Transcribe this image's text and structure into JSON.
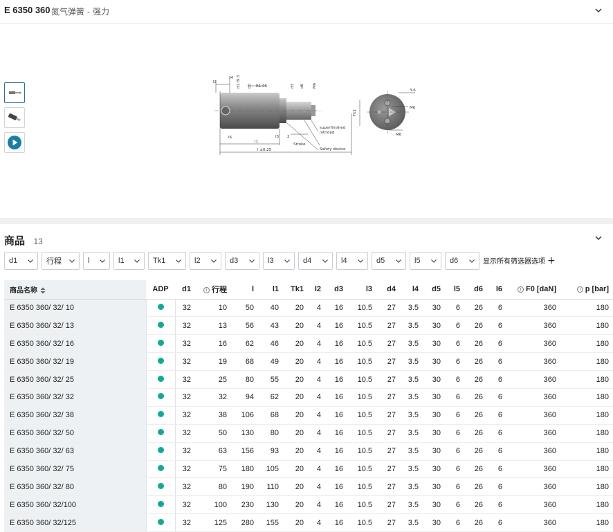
{
  "header": {
    "code": "E 6350 360",
    "name": "氮气弹簧 - 强力"
  },
  "drawing_labels": {
    "l2": "l2",
    "l4": "l4",
    "d1": "d1 f9.3",
    "d5": "d5",
    "r": "R1.05",
    "d3": "d3",
    "d6": "d6",
    "m6": "M6",
    "l6": "l6",
    "l1": "l1",
    "l3": "l3",
    "two": "2",
    "stroke": "Stroke",
    "l": "l ±0.25",
    "finish": "superfinished",
    "nitrided": "nitrided",
    "safety": "Safety device",
    "tk1": "Tk1",
    "dim36": "3.6",
    "m6b": "M6",
    "m6c": "M6"
  },
  "products": {
    "title": "商品",
    "count": "13",
    "filters": [
      "d1",
      "行程",
      "l",
      "l1",
      "Tk1",
      "l2",
      "d3",
      "l3",
      "d4",
      "l4",
      "d5",
      "l5",
      "d6"
    ],
    "show_all": "显示所有筛选器选项",
    "columns": [
      "商品名称",
      "ADP",
      "d1",
      "行程",
      "l",
      "l1",
      "Tk1",
      "l2",
      "d3",
      "l3",
      "d4",
      "l4",
      "d5",
      "l5",
      "d6",
      "l6",
      "F0 [daN]",
      "p [bar]"
    ],
    "rows": [
      {
        "name": "E 6350 360/ 32/ 10",
        "d1": "32",
        "stroke": "10",
        "l": "50",
        "l1": "40",
        "tk1": "20",
        "l2": "4",
        "d3": "16",
        "l3": "10.5",
        "d4": "27",
        "l4": "3.5",
        "d5": "30",
        "l5": "6",
        "d6": "26",
        "l6": "6",
        "f0": "360",
        "p": "180"
      },
      {
        "name": "E 6350 360/ 32/ 13",
        "d1": "32",
        "stroke": "13",
        "l": "56",
        "l1": "43",
        "tk1": "20",
        "l2": "4",
        "d3": "16",
        "l3": "10.5",
        "d4": "27",
        "l4": "3.5",
        "d5": "30",
        "l5": "6",
        "d6": "26",
        "l6": "6",
        "f0": "360",
        "p": "180"
      },
      {
        "name": "E 6350 360/ 32/ 16",
        "d1": "32",
        "stroke": "16",
        "l": "62",
        "l1": "46",
        "tk1": "20",
        "l2": "4",
        "d3": "16",
        "l3": "10.5",
        "d4": "27",
        "l4": "3.5",
        "d5": "30",
        "l5": "6",
        "d6": "26",
        "l6": "6",
        "f0": "360",
        "p": "180"
      },
      {
        "name": "E 6350 360/ 32/ 19",
        "d1": "32",
        "stroke": "19",
        "l": "68",
        "l1": "49",
        "tk1": "20",
        "l2": "4",
        "d3": "16",
        "l3": "10.5",
        "d4": "27",
        "l4": "3.5",
        "d5": "30",
        "l5": "6",
        "d6": "26",
        "l6": "6",
        "f0": "360",
        "p": "180"
      },
      {
        "name": "E 6350 360/ 32/ 25",
        "d1": "32",
        "stroke": "25",
        "l": "80",
        "l1": "55",
        "tk1": "20",
        "l2": "4",
        "d3": "16",
        "l3": "10.5",
        "d4": "27",
        "l4": "3.5",
        "d5": "30",
        "l5": "6",
        "d6": "26",
        "l6": "6",
        "f0": "360",
        "p": "180"
      },
      {
        "name": "E 6350 360/ 32/ 32",
        "d1": "32",
        "stroke": "32",
        "l": "94",
        "l1": "62",
        "tk1": "20",
        "l2": "4",
        "d3": "16",
        "l3": "10.5",
        "d4": "27",
        "l4": "3.5",
        "d5": "30",
        "l5": "6",
        "d6": "26",
        "l6": "6",
        "f0": "360",
        "p": "180"
      },
      {
        "name": "E 6350 360/ 32/ 38",
        "d1": "32",
        "stroke": "38",
        "l": "106",
        "l1": "68",
        "tk1": "20",
        "l2": "4",
        "d3": "16",
        "l3": "10.5",
        "d4": "27",
        "l4": "3.5",
        "d5": "30",
        "l5": "6",
        "d6": "26",
        "l6": "6",
        "f0": "360",
        "p": "180"
      },
      {
        "name": "E 6350 360/ 32/ 50",
        "d1": "32",
        "stroke": "50",
        "l": "130",
        "l1": "80",
        "tk1": "20",
        "l2": "4",
        "d3": "16",
        "l3": "10.5",
        "d4": "27",
        "l4": "3.5",
        "d5": "30",
        "l5": "6",
        "d6": "26",
        "l6": "6",
        "f0": "360",
        "p": "180"
      },
      {
        "name": "E 6350 360/ 32/ 63",
        "d1": "32",
        "stroke": "63",
        "l": "156",
        "l1": "93",
        "tk1": "20",
        "l2": "4",
        "d3": "16",
        "l3": "10.5",
        "d4": "27",
        "l4": "3.5",
        "d5": "30",
        "l5": "6",
        "d6": "26",
        "l6": "6",
        "f0": "360",
        "p": "180"
      },
      {
        "name": "E 6350 360/ 32/ 75",
        "d1": "32",
        "stroke": "75",
        "l": "180",
        "l1": "105",
        "tk1": "20",
        "l2": "4",
        "d3": "16",
        "l3": "10.5",
        "d4": "27",
        "l4": "3.5",
        "d5": "30",
        "l5": "6",
        "d6": "26",
        "l6": "6",
        "f0": "360",
        "p": "180"
      },
      {
        "name": "E 6350 360/ 32/ 80",
        "d1": "32",
        "stroke": "80",
        "l": "190",
        "l1": "110",
        "tk1": "20",
        "l2": "4",
        "d3": "16",
        "l3": "10.5",
        "d4": "27",
        "l4": "3.5",
        "d5": "30",
        "l5": "6",
        "d6": "26",
        "l6": "6",
        "f0": "360",
        "p": "180"
      },
      {
        "name": "E 6350 360/ 32/100",
        "d1": "32",
        "stroke": "100",
        "l": "230",
        "l1": "130",
        "tk1": "20",
        "l2": "4",
        "d3": "16",
        "l3": "10.5",
        "d4": "27",
        "l4": "3.5",
        "d5": "30",
        "l5": "6",
        "d6": "26",
        "l6": "6",
        "f0": "360",
        "p": "180"
      },
      {
        "name": "E 6350 360/ 32/125",
        "d1": "32",
        "stroke": "125",
        "l": "280",
        "l1": "155",
        "tk1": "20",
        "l2": "4",
        "d3": "16",
        "l3": "10.5",
        "d4": "27",
        "l4": "3.5",
        "d5": "30",
        "l5": "6",
        "d6": "26",
        "l6": "6",
        "f0": "360",
        "p": "180"
      }
    ]
  },
  "colors": {
    "adp_dot": "#14a89a",
    "play": "#1a7fa0",
    "active_border": "#2a6f94"
  }
}
